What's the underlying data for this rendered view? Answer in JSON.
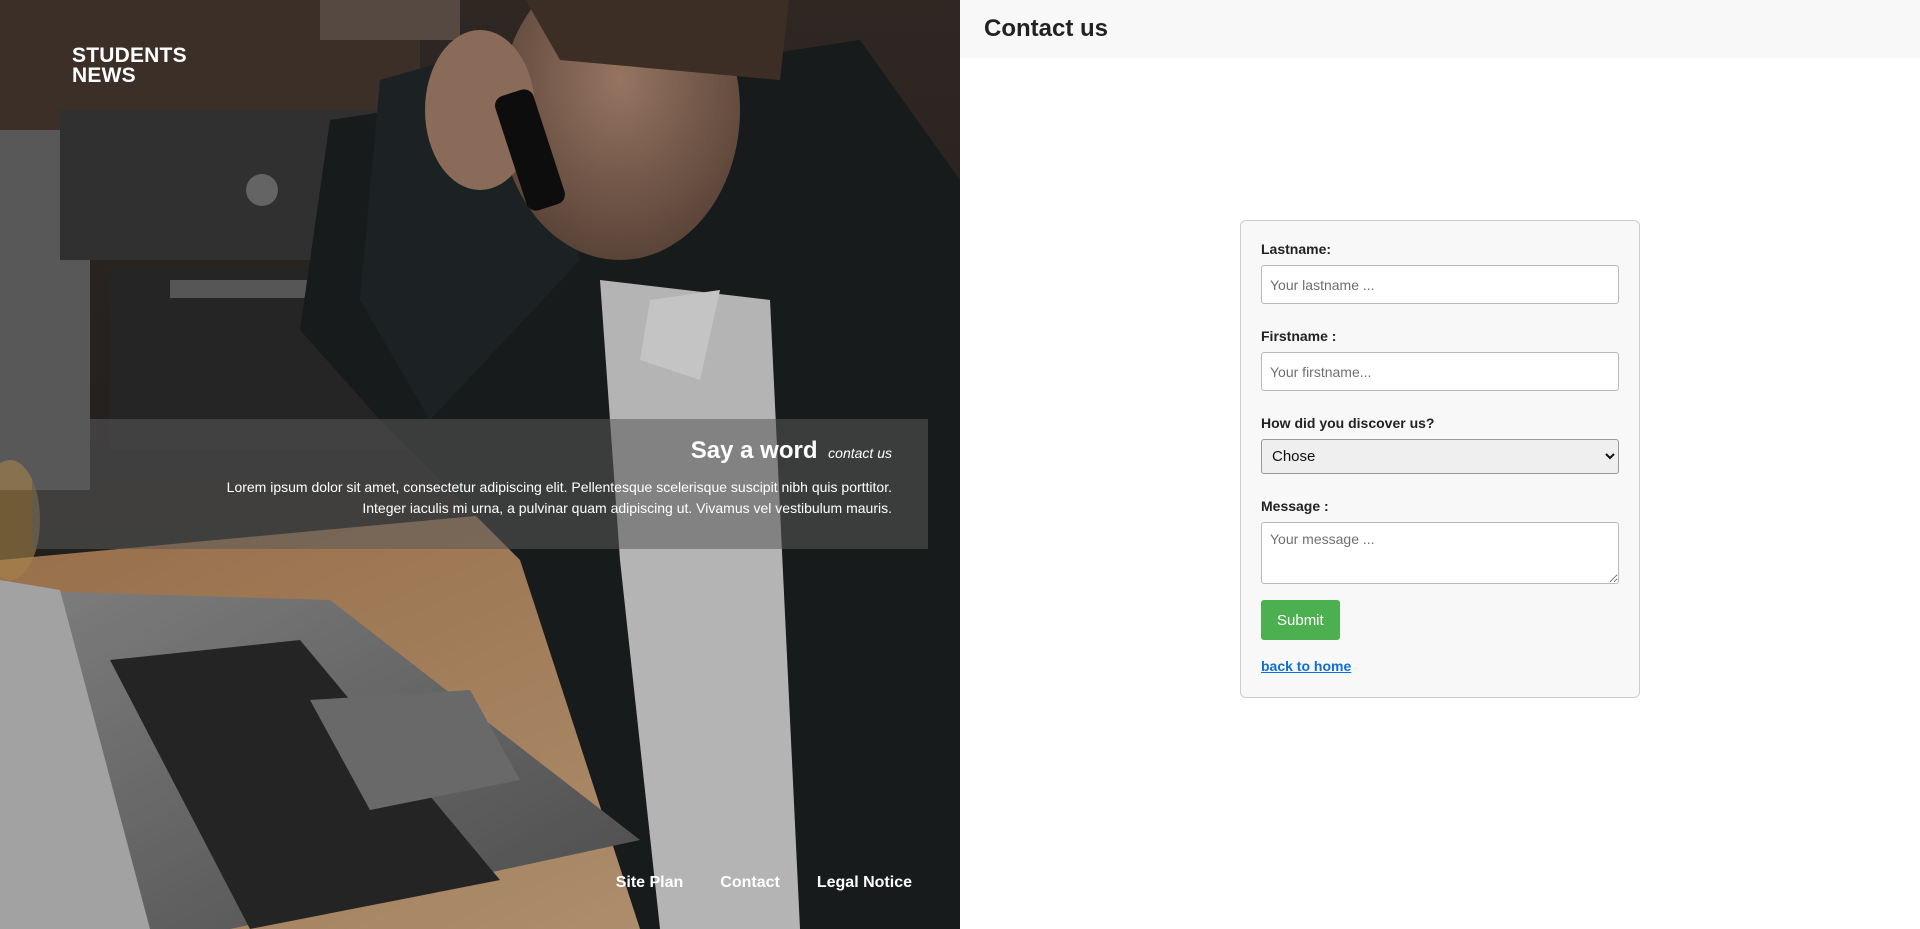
{
  "hero": {
    "logo_line1": "STUDENTS",
    "logo_line2": "NEWS",
    "promo_title": "Say a word",
    "promo_subtitle": "contact us",
    "promo_text_line1": "Lorem ipsum dolor sit amet, consectetur adipiscing elit. Pellentesque scelerisque suscipit nibh quis porttitor.",
    "promo_text_line2": "Integer iaculis mi urna, a pulvinar quam adipiscing ut. Vivamus vel vestibulum mauris.",
    "footer_links": [
      "Site Plan",
      "Contact",
      "Legal Notice"
    ]
  },
  "header": {
    "title": "Contact us"
  },
  "form": {
    "lastname_label": "Lastname:",
    "lastname_placeholder": "Your lastname ...",
    "firstname_label": "Firstname :",
    "firstname_placeholder": "Your firstname...",
    "discover_label": "How did you discover us?",
    "discover_selected": "Chose",
    "message_label": "Message :",
    "message_placeholder": "Your message ...",
    "submit_label": "Submit",
    "back_link": "back to home"
  },
  "colors": {
    "submit_bg": "#4caf50",
    "link": "#0b6fd6",
    "topbar_bg": "#f8f8f8"
  }
}
